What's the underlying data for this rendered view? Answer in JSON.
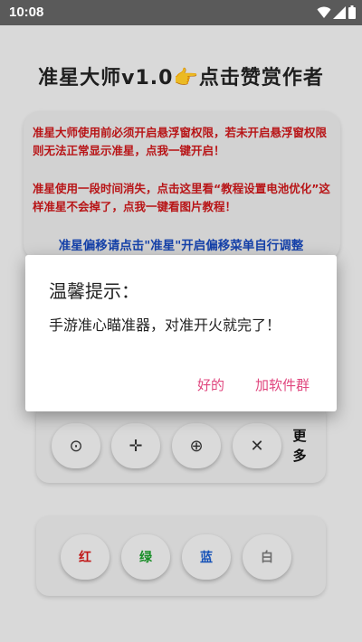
{
  "status_bar": {
    "time": "10:08",
    "icons": [
      "wifi-icon",
      "signal-icon",
      "battery-icon"
    ]
  },
  "app": {
    "title": "准星大师v1.0👉点击赞赏作者"
  },
  "notice": {
    "line_permission": "准星大师使用前必须开启悬浮窗权限，若未开启悬浮窗权限则无法正常显示准星，点我一键开启！",
    "line_battery": "准星使用一段时间消失，点击这里看“教程设置电池优化”这样准星不会掉了，点我一键看图片教程！",
    "line_offset": "准星偏移请点击\"准星\"开启偏移菜单自行调整"
  },
  "crosshair_buttons": [
    {
      "glyph": "⊙",
      "icon": "circle-dot-icon"
    },
    {
      "glyph": "✛",
      "icon": "cross-icon"
    },
    {
      "glyph": "⊕",
      "icon": "circle-cross-icon"
    },
    {
      "glyph": "✕",
      "icon": "x-cross-icon"
    }
  ],
  "more_label": "更多",
  "color_buttons": [
    {
      "label": "红",
      "color": "#d21a1a"
    },
    {
      "label": "绿",
      "color": "#1a9a2a"
    },
    {
      "label": "蓝",
      "color": "#1a5bc8"
    },
    {
      "label": "白",
      "color": "#777777"
    }
  ],
  "dialog": {
    "title": "温馨提示：",
    "message": "手游准心瞄准器，对准开火就完了！",
    "ok_label": "好的",
    "group_label": "加软件群",
    "accent": "#e0467e"
  }
}
